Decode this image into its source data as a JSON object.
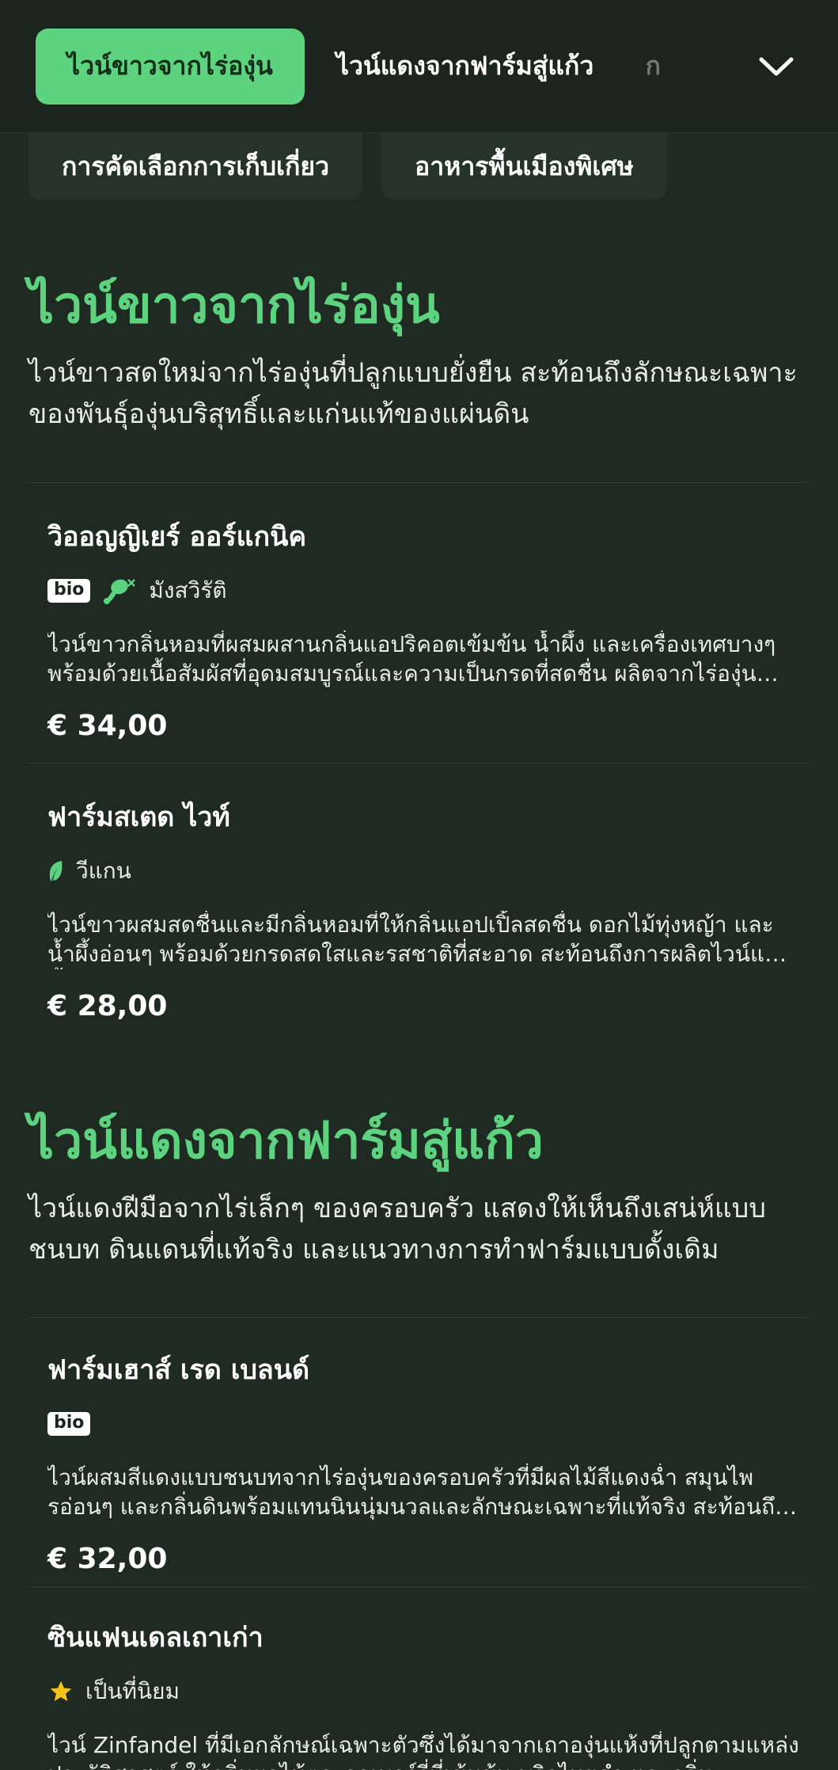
{
  "tabs": [
    {
      "label": "ไวน์ขาวจากไร่องุ่น",
      "active": true
    },
    {
      "label": "ไวน์แดงจากฟาร์มสู่แก้ว",
      "active": false
    },
    {
      "label": "ก",
      "active": false
    }
  ],
  "subfilters": [
    {
      "label": "การคัดเลือกการเก็บเกี่ยว"
    },
    {
      "label": "อาหารพื้นเมืองพิเศษ"
    }
  ],
  "sections": [
    {
      "title": "ไวน์ขาวจากไร่องุ่น",
      "description": "ไวน์ขาวสดใหม่จากไร่องุ่นที่ปลูกแบบยั่งยืน สะท้อนถึงลักษณะเฉพาะของพันธุ์องุ่นบริสุทธิ์และแก่นแท้ของแผ่นดิน",
      "items": [
        {
          "name": "วิออญญิเยร์ ออร์แกนิค",
          "badge_bio": "bio",
          "badge_label": "มังสวิรัติ",
          "description": "ไวน์ขาวกลิ่นหอมที่ผสมผสานกลิ่นแอปริคอตเข้มข้น น้ำผึ้ง และเครื่องเทศบางๆ พร้อมด้วยเนื้อสัมผัสที่อุดมสมบูรณ์และความเป็นกรดที่สดชื่น ผลิตจากไร่องุ่นออร์แกนิก",
          "price": "€ 34,00"
        },
        {
          "name": "ฟาร์มสเตด ไวท์",
          "badge_label": "วีแกน",
          "description": "ไวน์ขาวผสมสดชื่นและมีกลิ่นหอมที่ให้กลิ่นแอปเปิ้ลสดชื่น ดอกไม้ทุ่งหญ้า และน้ำผึ้งอ่อนๆ พร้อมด้วยกรดสดใสและรสชาติที่สะอาด สะท้อนถึงการผลิตไวน์แบบดั้งเดิม",
          "price": "€ 28,00"
        }
      ]
    },
    {
      "title": "ไวน์แดงจากฟาร์มสู่แก้ว",
      "description": "ไวน์แดงฝีมือจากไร่เล็กๆ ของครอบครัว แสดงให้เห็นถึงเสน่ห์แบบชนบท ดินแดนที่แท้จริง และแนวทางการทำฟาร์มแบบดั้งเดิม",
      "items": [
        {
          "name": "ฟาร์มเฮาส์ เรด เบลนด์",
          "badge_bio": "bio",
          "description": "ไวน์ผสมสีแดงแบบชนบทจากไร่องุ่นของครอบครัวที่มีผลไม้สีแดงฉ่ำ สมุนไพรอ่อนๆ และกลิ่นดินพร้อมแทนนินนุ่มนวลและลักษณะเฉพาะที่แท้จริง สะท้อนถึงดินแดน",
          "price": "€ 32,00"
        },
        {
          "name": "ซินแฟนเดลเถาเก่า",
          "badge_label": "เป็นที่นิยม",
          "description": "ไวน์ Zinfandel ที่มีเอกลักษณ์เฉพาะตัวซึ่งได้มาจากเถาองุ่นแห้งที่ปลูกตามแหล่งประวัติศาสตร์ ให้กลิ่นผลไม้ตระกูลเบอร์รี่ที่เข้มข้น พริกไทยดำ และกลิ่น"
        }
      ]
    }
  ],
  "colors": {
    "accent": "#5ed37f",
    "background": "#1f2a23",
    "star": "#f4c21a"
  },
  "icons": {
    "chevron": "chevron-down-icon",
    "no_meat": "no-meat-icon",
    "leaf": "leaf-icon",
    "star": "star-icon"
  }
}
